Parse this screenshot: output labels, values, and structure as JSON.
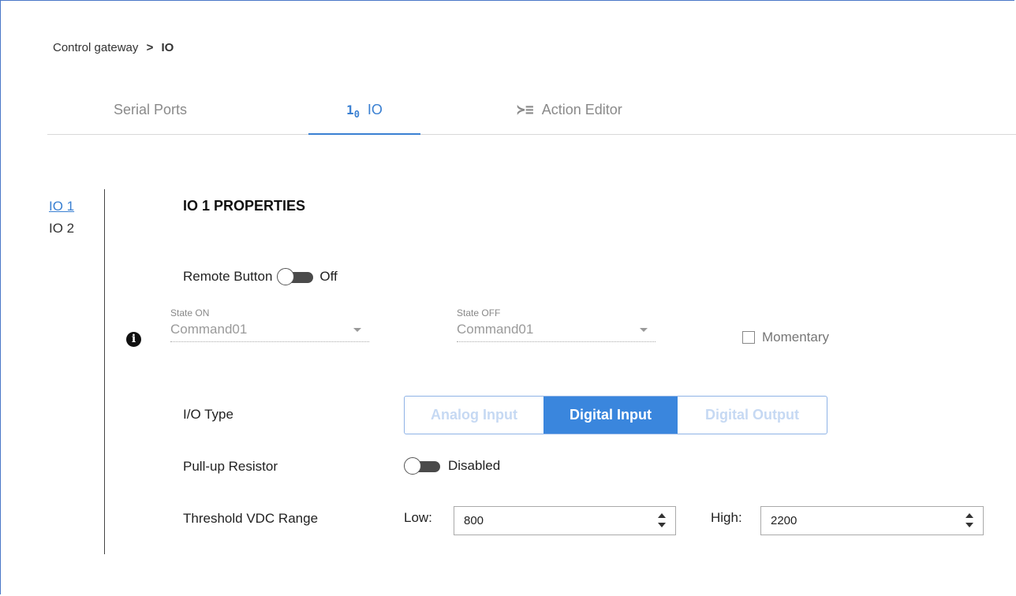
{
  "breadcrumb": {
    "parent": "Control gateway",
    "separator": ">",
    "current": "IO"
  },
  "tabs": [
    {
      "label": "Serial Ports",
      "icon": ""
    },
    {
      "label": "IO",
      "icon": "io-icon"
    },
    {
      "label": "Action Editor",
      "icon": "action-editor-icon"
    }
  ],
  "tab_icons": {
    "io_main": "1",
    "io_sub": "0",
    "action": "≻≡"
  },
  "sidenav": {
    "items": [
      "IO 1",
      "IO 2"
    ]
  },
  "section_title": "IO 1 PROPERTIES",
  "remote_button": {
    "label": "Remote Button",
    "state": "Off"
  },
  "state_on": {
    "label": "State ON",
    "value": "Command01"
  },
  "state_off": {
    "label": "State OFF",
    "value": "Command01"
  },
  "momentary": {
    "label": "Momentary"
  },
  "io_type": {
    "label": "I/O Type",
    "options": [
      "Analog Input",
      "Digital Input",
      "Digital Output"
    ],
    "selected": "Digital Input"
  },
  "pullup": {
    "label": "Pull-up Resistor",
    "state": "Disabled"
  },
  "threshold": {
    "label": "Threshold VDC Range",
    "low_label": "Low:",
    "low_value": "800",
    "high_label": "High:",
    "high_value": "2200"
  },
  "colors": {
    "accent": "#3a86dd",
    "tab_active": "#3a80d2"
  }
}
